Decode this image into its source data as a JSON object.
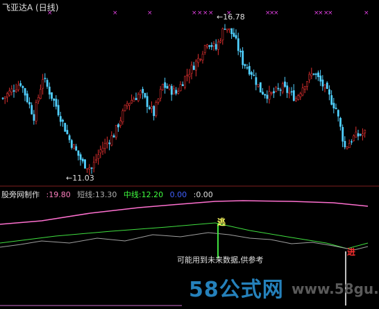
{
  "window": {
    "title": "飞亚达A (日线)",
    "title_color": "#e0e0e0"
  },
  "price_panel": {
    "high_label": "16.78",
    "low_label": "11.03",
    "up_color": "#e03030",
    "down_color": "#50d0ff",
    "marker_color": "#e040e0"
  },
  "indicator_panel": {
    "items": [
      {
        "label": "股旁网制作",
        "color": "#e0e0e0"
      },
      {
        "label": ":19.80",
        "color": "#ff80c0"
      },
      {
        "label": "短线:13.30",
        "color": "#b0b0b0"
      },
      {
        "label": "中线:12.20",
        "color": "#40ff40"
      },
      {
        "label": "0.00",
        "color": "#4060ff"
      },
      {
        "label": ":0.00",
        "color": "#e0e0e0"
      }
    ],
    "escape_label": "逃",
    "enter_label": "进",
    "warning": "可能用到未来数据,供参考",
    "line_colors": {
      "pink": "#ff70d0",
      "green": "#40e040",
      "gray": "#a0a0a0"
    }
  },
  "watermark": {
    "logo_text": "58公式网",
    "url_text": "www.58gu.com"
  }
}
